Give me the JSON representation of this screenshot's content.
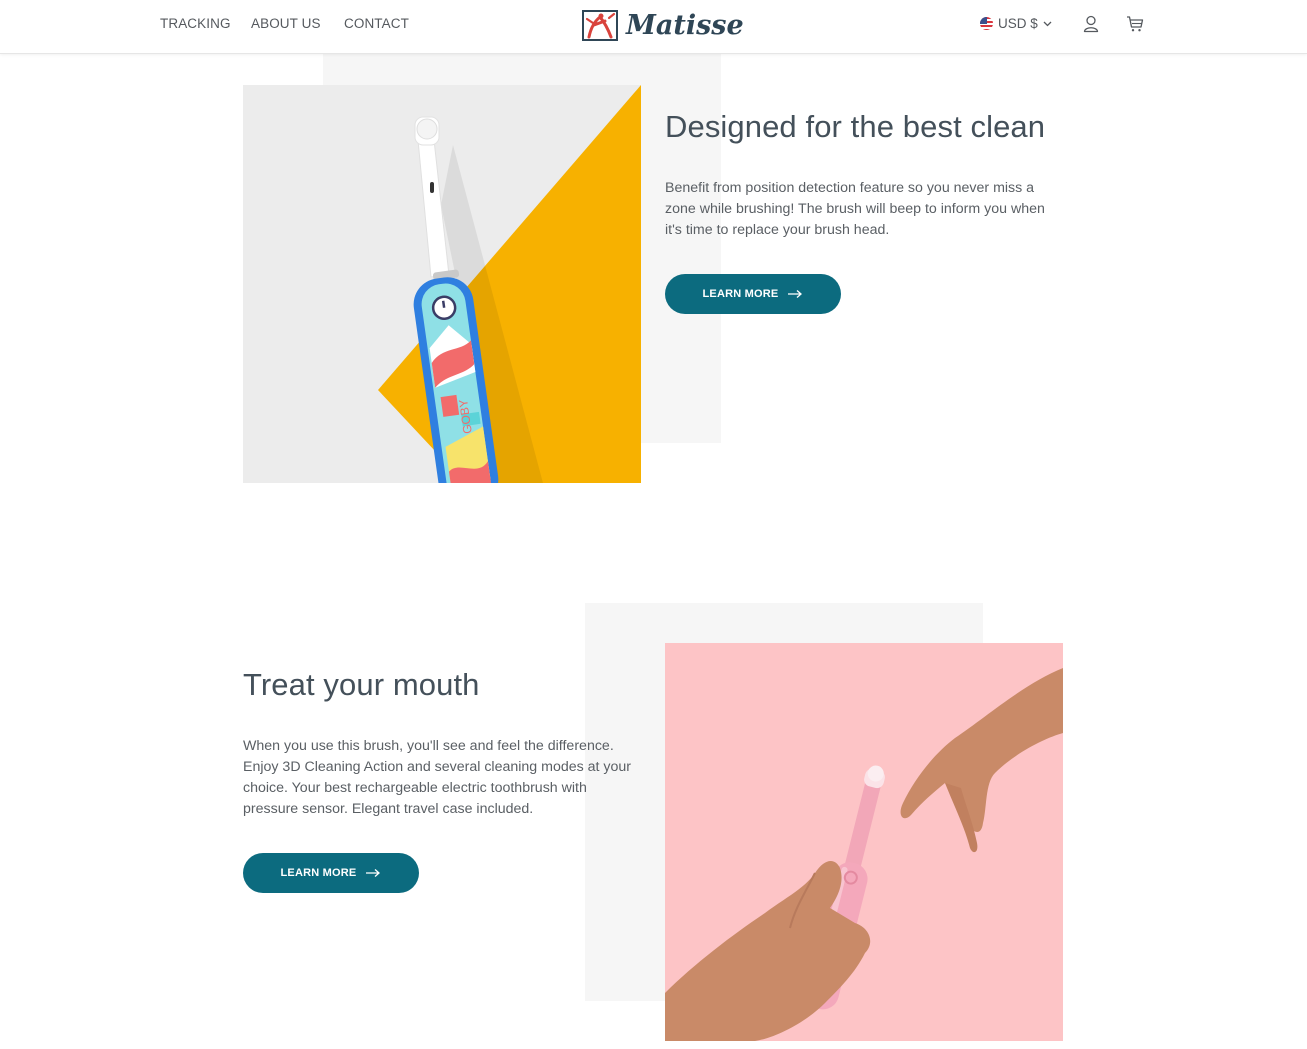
{
  "nav": {
    "links": [
      "TRACKING",
      "ABOUT US",
      "CONTACT"
    ]
  },
  "brand": {
    "name": "Matisse"
  },
  "header": {
    "currency": "USD $",
    "icons": [
      "flag-us-icon",
      "chevron-down-icon",
      "user-icon",
      "cart-icon"
    ]
  },
  "section1": {
    "title": "Designed for the best clean",
    "body": "Benefit from position detection feature so you never miss a zone while brushing! The brush will beep to inform you when it's time to replace your brush head.",
    "button_label": "LEARN MORE",
    "image_brand": "GOBY"
  },
  "section2": {
    "title": "Treat your mouth",
    "body": "When you use this brush, you'll see and feel the difference. Enjoy 3D Cleaning Action and several cleaning modes at your choice. Your best rechargeable electric toothbrush with pressure sensor. Elegant travel case included.",
    "button_label": "LEARN MORE"
  },
  "colors": {
    "accent": "#0c6b7f",
    "heading": "#44505a",
    "yellow": "#f7b100",
    "pink_bg": "#fdc4c6",
    "light_bg": "#f6f6f6"
  }
}
